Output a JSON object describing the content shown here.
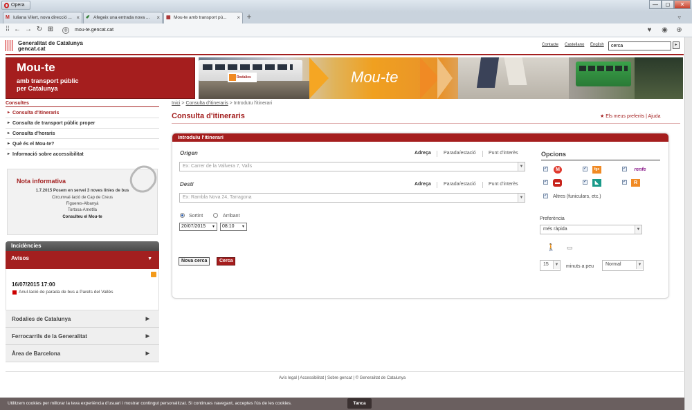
{
  "browser": {
    "menu_label": "Opera",
    "tabs": [
      {
        "favicon": "M",
        "title": "Iuliana Vilert, nova direcció ...",
        "favicon_color": "#c5221f"
      },
      {
        "favicon": "✐",
        "title": "Afegeix una entrada nova ...",
        "favicon_color": "#2a7a2a"
      },
      {
        "favicon": "▦",
        "title": "Mou-te amb transport pú...",
        "favicon_color": "#a31f1f"
      }
    ],
    "new_tab": "+",
    "address": "mou-te.gencat.cat",
    "window_controls": [
      "—",
      "◻",
      "✕"
    ]
  },
  "site": {
    "gencat_name": "Generalitat de Catalunya",
    "gencat_domain": "gencat.cat",
    "top_links": [
      "Contacte",
      "Castellano",
      "English"
    ],
    "search_value": "cerca",
    "search_btn": "▸",
    "brand_title": "Mou-te",
    "brand_sub1": "amb transport públic",
    "brand_sub2": "per Catalunya",
    "banner_text": "Mou-te",
    "banner_rodalies": "Rodalies"
  },
  "sidebar": {
    "head": "Consultes",
    "items": [
      {
        "label": "Consulta d'itineraris"
      },
      {
        "label": "Consulta de transport públic proper"
      },
      {
        "label": "Consulta d'horaris"
      },
      {
        "label": "Què és el Mou-te?"
      },
      {
        "label": "Informació sobre accessibilitat"
      }
    ],
    "nota": {
      "title": "Nota informativa",
      "lines": [
        "1.7.2015 Posem en servei 3 noves línies de bus",
        "Circumval·lació de Cap de Creus",
        "Figueres-Albanyà",
        "Tortosa-Arnetlla",
        "Consulteu el Mou-te"
      ]
    },
    "incidencies": "Incidències",
    "avisos": "Avisos",
    "avis_date": "16/07/2015 17:00",
    "avis_text": "Anul·lació de parada de bus a Parets del Vallès",
    "accordion": [
      "Rodalies de Catalunya",
      "Ferrocarrils de la Generalitat",
      "Àrea de Barcelona"
    ]
  },
  "main": {
    "breadcrumb": [
      "Inici",
      "Consulta d'itineraris",
      "Introduïu l'itinerari"
    ],
    "title": "Consulta d'itineraris",
    "pref_links": "★ Els meus preferits | Ajuda",
    "panel_title": "Introduïu l'itinerari",
    "origen_label": "Origen",
    "desti_label": "Destí",
    "modes": [
      "Adreça",
      "Parada/estació",
      "Punt d'interès"
    ],
    "origen_placeholder": "Ex: Carrer de la Vallvera 7, Valls",
    "desti_placeholder": "Ex: Rambla Nova 24, Tarragona",
    "sortint": "Sortint",
    "arribant": "Arribant",
    "date": "20/07/2015",
    "time": "08:10",
    "nova_cerca": "Nova cerca",
    "cerca": "Cerca",
    "opcions_title": "Opcions",
    "opcions_icons": [
      {
        "name": "metro-icon",
        "glyph": "M",
        "color": "#e03a2e"
      },
      {
        "name": "fgc-icon",
        "glyph": "fgc",
        "color": "#f08a24"
      },
      {
        "name": "renfe-icon",
        "glyph": "renfe",
        "color": "#8a1a8a"
      },
      {
        "name": "bus-icon",
        "glyph": "▬",
        "color": "#c8241c"
      },
      {
        "name": "tram-icon",
        "glyph": "◣",
        "color": "#1a9a8a"
      },
      {
        "name": "rodalies-icon",
        "glyph": "R",
        "color": "#f08a24"
      }
    ],
    "altres": "Altres (funiculars, etc.)",
    "preferencia_label": "Preferència",
    "preferencia_value": "més ràpida",
    "minuts_value": "15",
    "minuts_label": "minuts a peu",
    "walk_speed": "Normal"
  },
  "footer": {
    "links": "Avís legal | Accessibilitat | Sobre gencat | © Generalitat de Catalunya"
  },
  "cookie": {
    "text": "Utilitzem cookies per millorar la teva experiència d'usuari i mostrar contingut personalitzat. Si continues navegant, acceptes l'ús de les cookies.",
    "button": "Tanca"
  }
}
